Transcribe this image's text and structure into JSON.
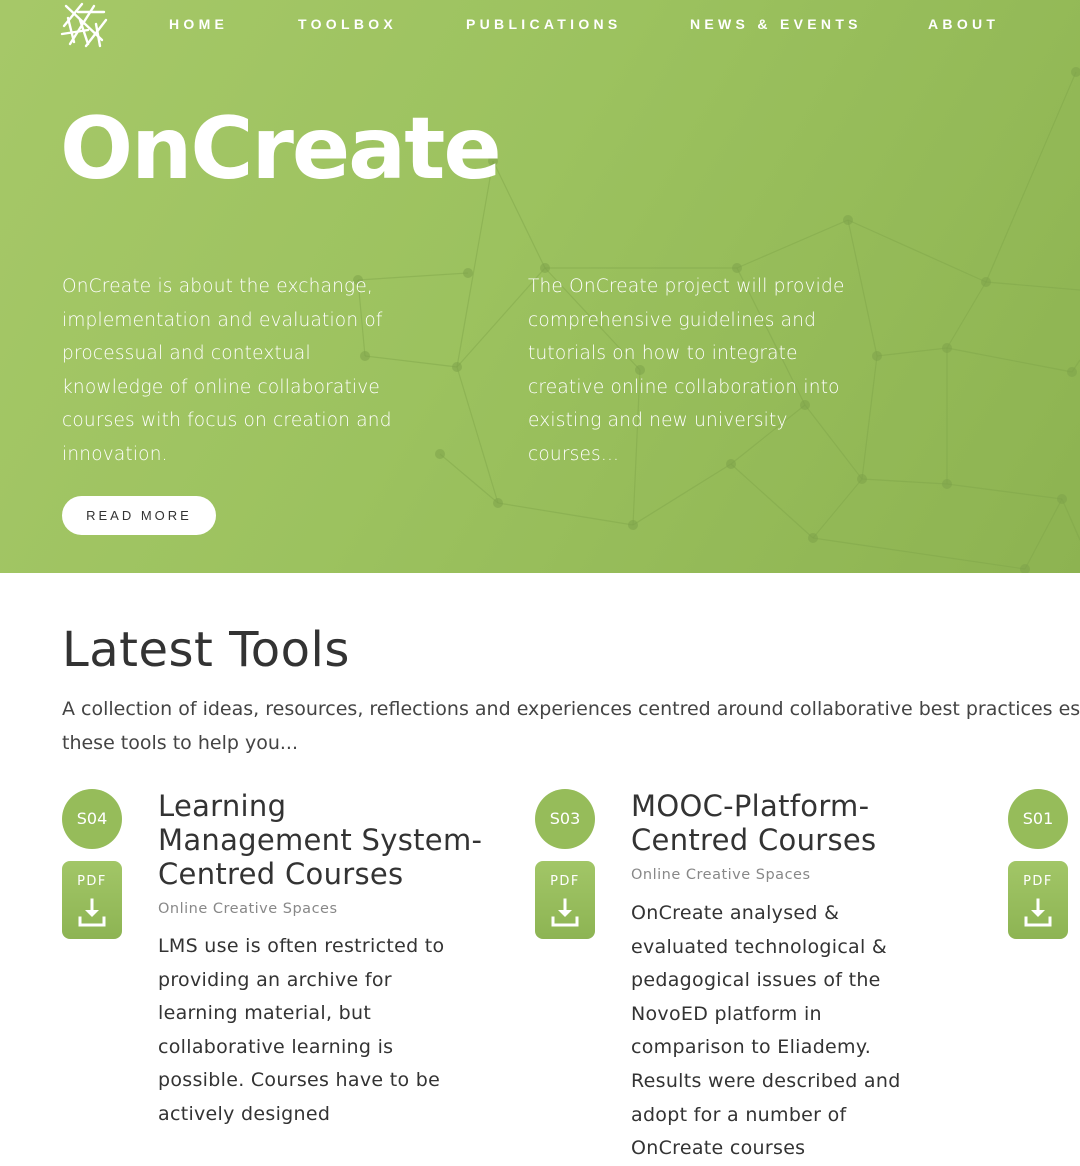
{
  "nav": {
    "items": [
      {
        "label": "HOME"
      },
      {
        "label": "TOOLBOX"
      },
      {
        "label": "PUBLICATIONS"
      },
      {
        "label": "NEWS & EVENTS"
      },
      {
        "label": "ABOUT"
      }
    ]
  },
  "hero": {
    "title": "OnCreate",
    "col1": "OnCreate is about the exchange, implementation and evaluation of processual and contextual knowledge of online collaborative courses with focus on creation and innovation.",
    "col2": "The OnCreate project will provide comprehensive guidelines and tutorials on how to integrate creative online collaboration into existing and new university courses...",
    "button": "READ MORE"
  },
  "section": {
    "title": "Latest Tools",
    "description_line1": "A collection of ideas, resources, reflections and experiences centred around collaborative best practices establi",
    "description_line2": "these tools to help you..."
  },
  "tools": [
    {
      "badge": "S04",
      "pdf": "PDF",
      "title": "Learning Management System-Centred Courses",
      "category": "Online Creative Spaces",
      "body": "LMS use is often restricted to providing an archive for learning material, but collaborative learning is possible. Courses have to be actively designed"
    },
    {
      "badge": "S03",
      "pdf": "PDF",
      "title": "MOOC-Platform-Centred Courses",
      "category": "Online Creative Spaces",
      "body": "OnCreate analysed & evaluated technological & pedagogical issues of the NovoED platform in comparison to Eliademy. Results were described and adopt for a number of OnCreate courses"
    },
    {
      "badge": "S01",
      "pdf": "PDF"
    }
  ],
  "colors": {
    "brand_green": "#9cc25f",
    "text_dark": "#333333",
    "text_muted": "#888888"
  }
}
